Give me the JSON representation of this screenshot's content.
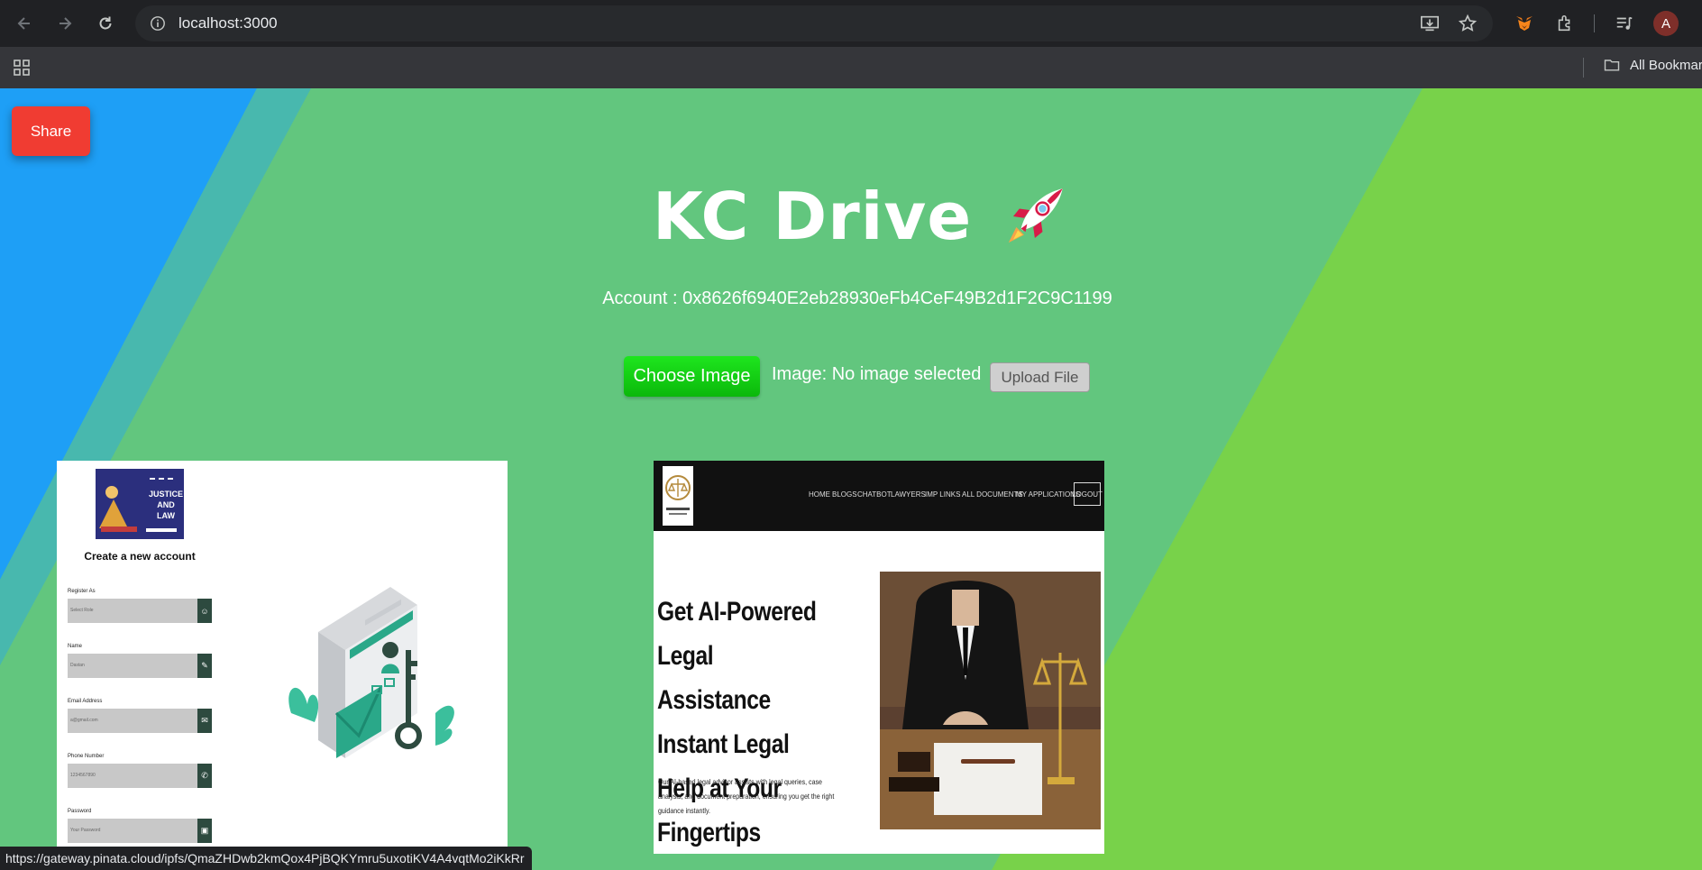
{
  "browser": {
    "url": "localhost:3000",
    "bookmarks_label": "All Bookmarks",
    "profile_initial": "A",
    "status_url": "https://gateway.pinata.cloud/ipfs/QmaZHDwb2kmQox4PjBQKYmru5uxotiKV4A4vqtMo2iKkRr"
  },
  "app": {
    "share_label": "Share",
    "title": "KC Drive",
    "account_text": "Account : 0x8626f6940E2eb28930eFb4CeF49B2d1F2C9C1199",
    "choose_label": "Choose Image",
    "image_status": "Image: No image selected",
    "upload_label": "Upload File"
  },
  "thumb1": {
    "logo_text": "JUSTICE AND LAW",
    "heading": "Create a new account",
    "fields": [
      {
        "label": "Register As",
        "value": "Select Role"
      },
      {
        "label": "Name",
        "value": "Dastan"
      },
      {
        "label": "Email Address",
        "value": "a@gmail.com"
      },
      {
        "label": "Phone Number",
        "value": "1234567890"
      },
      {
        "label": "Password",
        "value": "Your Password"
      }
    ]
  },
  "thumb2": {
    "nav_items": [
      "HOME",
      "BLOGS",
      "CHATBOT",
      "LAWYERS",
      "IMP LINKS",
      "ALL DOCUMENTS",
      "MY APPLICATIONS"
    ],
    "logout": "LOGOUT",
    "headline": "Get AI-Powered Legal Assistance Instant Legal Help at Your Fingertips",
    "description": "Our AI-based legal advisor assists with legal queries, case analysis, and document preparation, ensuring you get the right guidance instantly."
  },
  "colors": {
    "bg_green": "#62c67e",
    "bg_blue": "#1e9ff6",
    "bg_lime": "#78d24a",
    "share_red": "#f03c32",
    "choose_green": "#14cf14"
  }
}
